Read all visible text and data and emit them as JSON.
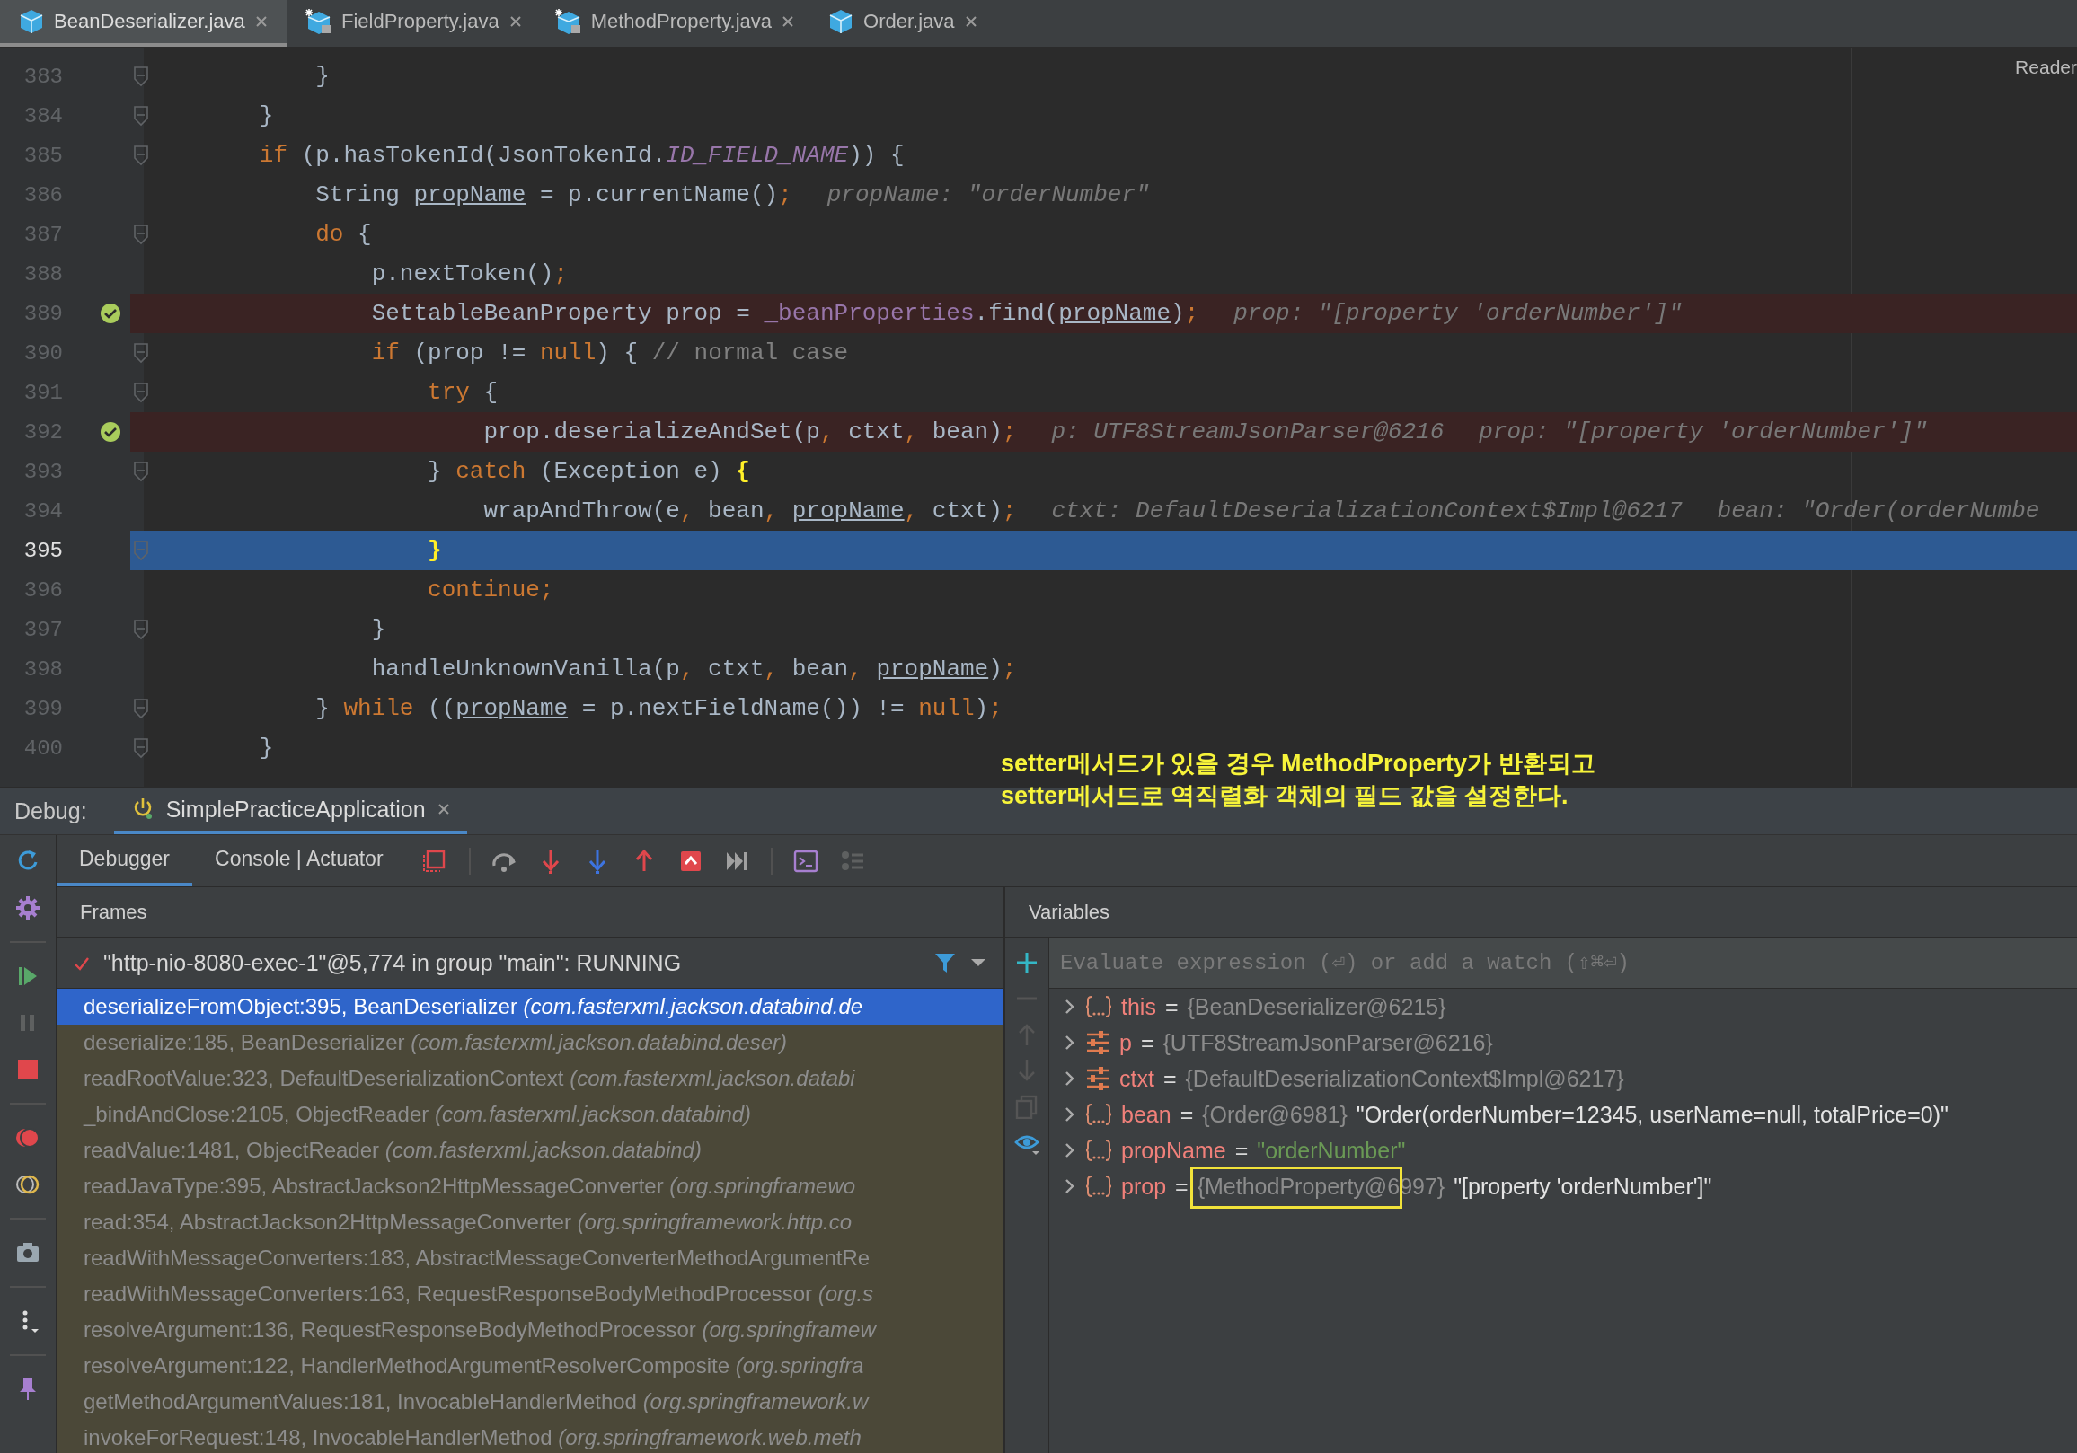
{
  "tabs": [
    {
      "label": "BeanDeserializer.java",
      "kind": "class",
      "selected": true
    },
    {
      "label": "FieldProperty.java",
      "kind": "library",
      "selected": false
    },
    {
      "label": "MethodProperty.java",
      "kind": "library",
      "selected": false
    },
    {
      "label": "Order.java",
      "kind": "class",
      "selected": false
    }
  ],
  "editor": {
    "side_label": "Reader",
    "lines": [
      {
        "number": "383",
        "breakpoint": false,
        "current": false,
        "fold": true,
        "tokens": [
          {
            "text": "            }",
            "kind": "plain"
          }
        ]
      },
      {
        "number": "384",
        "breakpoint": false,
        "current": false,
        "fold": true,
        "tokens": [
          {
            "text": "        }",
            "kind": "plain"
          }
        ]
      },
      {
        "number": "385",
        "breakpoint": false,
        "current": false,
        "fold": true,
        "tokens": [
          {
            "text": "        if",
            "kind": "keyword"
          },
          {
            "text": " (p.hasTokenId(JsonTokenId.",
            "kind": "plain"
          },
          {
            "text": "ID_FIELD_NAME",
            "kind": "constant"
          },
          {
            "text": ")) {",
            "kind": "plain"
          }
        ]
      },
      {
        "number": "386",
        "breakpoint": false,
        "current": false,
        "fold": false,
        "tokens": [
          {
            "text": "            String ",
            "kind": "plain"
          },
          {
            "text": "propName",
            "kind": "variable"
          },
          {
            "text": " = p.currentName()",
            "kind": "plain"
          },
          {
            "text": ";",
            "kind": "keyword"
          },
          {
            "text": "propName: \"orderNumber\"",
            "kind": "hint"
          }
        ]
      },
      {
        "number": "387",
        "breakpoint": false,
        "current": false,
        "fold": true,
        "tokens": [
          {
            "text": "            do",
            "kind": "keyword"
          },
          {
            "text": " {",
            "kind": "plain"
          }
        ]
      },
      {
        "number": "388",
        "breakpoint": false,
        "current": false,
        "fold": false,
        "tokens": [
          {
            "text": "                p.nextToken()",
            "kind": "plain"
          },
          {
            "text": ";",
            "kind": "keyword"
          }
        ]
      },
      {
        "number": "389",
        "breakpoint": true,
        "current": false,
        "fold": false,
        "tokens": [
          {
            "text": "                SettableBeanProperty prop = ",
            "kind": "plain"
          },
          {
            "text": "_beanProperties",
            "kind": "field"
          },
          {
            "text": ".find(",
            "kind": "plain"
          },
          {
            "text": "propName",
            "kind": "variable"
          },
          {
            "text": ")",
            "kind": "plain"
          },
          {
            "text": ";",
            "kind": "keyword"
          },
          {
            "text": "prop: \"[property 'orderNumber']\"",
            "kind": "hint"
          }
        ]
      },
      {
        "number": "390",
        "breakpoint": false,
        "current": false,
        "fold": true,
        "tokens": [
          {
            "text": "                if",
            "kind": "keyword"
          },
          {
            "text": " (prop != ",
            "kind": "plain"
          },
          {
            "text": "null",
            "kind": "keyword"
          },
          {
            "text": ") { ",
            "kind": "plain"
          },
          {
            "text": "// normal case",
            "kind": "comment"
          }
        ]
      },
      {
        "number": "391",
        "breakpoint": false,
        "current": false,
        "fold": true,
        "tokens": [
          {
            "text": "                    try",
            "kind": "keyword"
          },
          {
            "text": " {",
            "kind": "plain"
          }
        ]
      },
      {
        "number": "392",
        "breakpoint": true,
        "current": false,
        "fold": false,
        "tokens": [
          {
            "text": "                        prop.deserializeAndSet(p",
            "kind": "plain"
          },
          {
            "text": ",",
            "kind": "keyword"
          },
          {
            "text": " ctxt",
            "kind": "plain"
          },
          {
            "text": ",",
            "kind": "keyword"
          },
          {
            "text": " bean)",
            "kind": "plain"
          },
          {
            "text": ";",
            "kind": "keyword"
          },
          {
            "text": "p: UTF8StreamJsonParser@6216",
            "kind": "hint"
          },
          {
            "text": "prop: \"[property 'orderNumber']\"",
            "kind": "hint"
          }
        ]
      },
      {
        "number": "393",
        "breakpoint": false,
        "current": false,
        "fold": true,
        "tokens": [
          {
            "text": "                    } ",
            "kind": "plain"
          },
          {
            "text": "catch",
            "kind": "keyword"
          },
          {
            "text": " (Exception e) ",
            "kind": "plain"
          },
          {
            "text": "{",
            "kind": "brace"
          }
        ]
      },
      {
        "number": "394",
        "breakpoint": false,
        "current": false,
        "fold": false,
        "tokens": [
          {
            "text": "                        wrapAndThrow(e",
            "kind": "plain"
          },
          {
            "text": ",",
            "kind": "keyword"
          },
          {
            "text": " bean",
            "kind": "plain"
          },
          {
            "text": ", ",
            "kind": "keyword"
          },
          {
            "text": "propName",
            "kind": "variable"
          },
          {
            "text": ",",
            "kind": "keyword"
          },
          {
            "text": " ctxt)",
            "kind": "plain"
          },
          {
            "text": ";",
            "kind": "keyword"
          },
          {
            "text": "ctxt: DefaultDeserializationContext$Impl@6217",
            "kind": "hint"
          },
          {
            "text": "bean: \"Order(orderNumbe",
            "kind": "hint"
          }
        ]
      },
      {
        "number": "395",
        "breakpoint": false,
        "current": true,
        "fold": true,
        "tokens": [
          {
            "text": "                    }",
            "kind": "brace"
          }
        ]
      },
      {
        "number": "396",
        "breakpoint": false,
        "current": false,
        "fold": false,
        "tokens": [
          {
            "text": "                    continue;",
            "kind": "keyword"
          }
        ]
      },
      {
        "number": "397",
        "breakpoint": false,
        "current": false,
        "fold": true,
        "tokens": [
          {
            "text": "                }",
            "kind": "plain"
          }
        ]
      },
      {
        "number": "398",
        "breakpoint": false,
        "current": false,
        "fold": false,
        "tokens": [
          {
            "text": "                handleUnknownVanilla(p",
            "kind": "plain"
          },
          {
            "text": ",",
            "kind": "keyword"
          },
          {
            "text": " ctxt",
            "kind": "plain"
          },
          {
            "text": ",",
            "kind": "keyword"
          },
          {
            "text": " bean",
            "kind": "plain"
          },
          {
            "text": ", ",
            "kind": "keyword"
          },
          {
            "text": "propName",
            "kind": "variable"
          },
          {
            "text": ")",
            "kind": "plain"
          },
          {
            "text": ";",
            "kind": "keyword"
          }
        ]
      },
      {
        "number": "399",
        "breakpoint": false,
        "current": false,
        "fold": true,
        "tokens": [
          {
            "text": "            } ",
            "kind": "plain"
          },
          {
            "text": "while",
            "kind": "keyword"
          },
          {
            "text": " ((",
            "kind": "plain"
          },
          {
            "text": "propName",
            "kind": "variable"
          },
          {
            "text": " = p.nextFieldName()) != ",
            "kind": "plain"
          },
          {
            "text": "null",
            "kind": "keyword"
          },
          {
            "text": ")",
            "kind": "plain"
          },
          {
            "text": ";",
            "kind": "keyword"
          }
        ]
      },
      {
        "number": "400",
        "breakpoint": false,
        "current": false,
        "fold": true,
        "tokens": [
          {
            "text": "        }",
            "kind": "plain"
          }
        ]
      }
    ]
  },
  "note": {
    "lines": [
      "setter메서드가 있을 경우 MethodProperty가 반환되고",
      "setter메서드로 역직렬화 객체의 필드 값을 설정한다."
    ]
  },
  "debug": {
    "label": "Debug:",
    "session": "SimplePracticeApplication",
    "tabs": [
      {
        "label": "Debugger",
        "selected": true
      },
      {
        "label": "Console | Actuator",
        "selected": false
      }
    ],
    "frames": {
      "title": "Frames",
      "thread": "\"http-nio-8080-exec-1\"@5,774 in group \"main\": RUNNING",
      "items": [
        {
          "location": "deserializeFromObject:395, BeanDeserializer",
          "package": "(com.fasterxml.jackson.databind.de",
          "selected": true,
          "library": true
        },
        {
          "location": "deserialize:185, BeanDeserializer",
          "package": "(com.fasterxml.jackson.databind.deser)",
          "selected": false,
          "library": true
        },
        {
          "location": "readRootValue:323, DefaultDeserializationContext",
          "package": "(com.fasterxml.jackson.databi",
          "selected": false,
          "library": true
        },
        {
          "location": "_bindAndClose:2105, ObjectReader",
          "package": "(com.fasterxml.jackson.databind)",
          "selected": false,
          "library": true
        },
        {
          "location": "readValue:1481, ObjectReader",
          "package": "(com.fasterxml.jackson.databind)",
          "selected": false,
          "library": true
        },
        {
          "location": "readJavaType:395, AbstractJackson2HttpMessageConverter",
          "package": "(org.springframewo",
          "selected": false,
          "library": true
        },
        {
          "location": "read:354, AbstractJackson2HttpMessageConverter",
          "package": "(org.springframework.http.co",
          "selected": false,
          "library": true
        },
        {
          "location": "readWithMessageConverters:183, AbstractMessageConverterMethodArgumentRe",
          "selected": false,
          "library": true
        },
        {
          "location": "readWithMessageConverters:163, RequestResponseBodyMethodProcessor",
          "package": "(org.s",
          "selected": false,
          "library": true
        },
        {
          "location": "resolveArgument:136, RequestResponseBodyMethodProcessor",
          "package": "(org.springframew",
          "selected": false,
          "library": true
        },
        {
          "location": "resolveArgument:122, HandlerMethodArgumentResolverComposite",
          "package": "(org.springfra",
          "selected": false,
          "library": true
        },
        {
          "location": "getMethodArgumentValues:181, InvocableHandlerMethod",
          "package": "(org.springframework.w",
          "selected": false,
          "library": true
        },
        {
          "location": "invokeForRequest:148, InvocableHandlerMethod",
          "package": "(org.springframework.web.meth",
          "selected": false,
          "library": true
        }
      ]
    },
    "variables": {
      "title": "Variables",
      "placeholder": "Evaluate expression (⏎) or add a watch (⇧⌘⏎)",
      "items": [
        {
          "kind": "object",
          "name": "this",
          "equals": "=",
          "ref": "{BeanDeserializer@6215}",
          "marked": false
        },
        {
          "kind": "field",
          "name": "p",
          "equals": "=",
          "ref": "{UTF8StreamJsonParser@6216}",
          "marked": false
        },
        {
          "kind": "field",
          "name": "ctxt",
          "equals": "=",
          "ref": "{DefaultDeserializationContext$Impl@6217}",
          "marked": false
        },
        {
          "kind": "object",
          "name": "bean",
          "equals": "=",
          "ref": "{Order@6981}",
          "text": "\"Order(orderNumber=12345, userName=null, totalPrice=0)\"",
          "marked": false
        },
        {
          "kind": "object",
          "name": "propName",
          "equals": "=",
          "string": "\"orderNumber\"",
          "marked": false
        },
        {
          "kind": "object",
          "name": "prop",
          "equals": "=",
          "ref": "{MethodProperty@6997}",
          "text": "\"[property 'orderNumber']\"",
          "marked": true
        }
      ]
    }
  }
}
